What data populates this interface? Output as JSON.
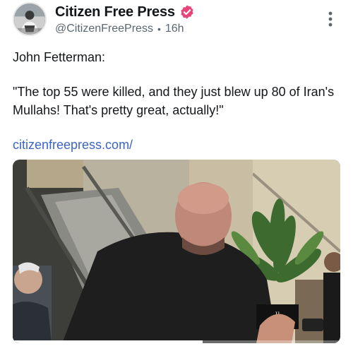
{
  "post": {
    "author": {
      "display_name": "Citizen Free Press",
      "handle": "@CitizenFreePress",
      "verified_icon": "verified-badge-icon",
      "verified_color": "#e8457a"
    },
    "timestamp": "16h",
    "separator": "•",
    "more_icon": "more-vertical-icon",
    "text_line1": "John Fetterman:",
    "text_quote": "\"The top 55 were killed, and they just blew up 80 of Iran's Mullahs! That's pretty great, actually!\"",
    "link_text": "citizenfreepress.com/",
    "link_color": "#3c64c8"
  },
  "media": {
    "type": "video",
    "sign_text": "ll\nurs",
    "progress": 0.58
  }
}
